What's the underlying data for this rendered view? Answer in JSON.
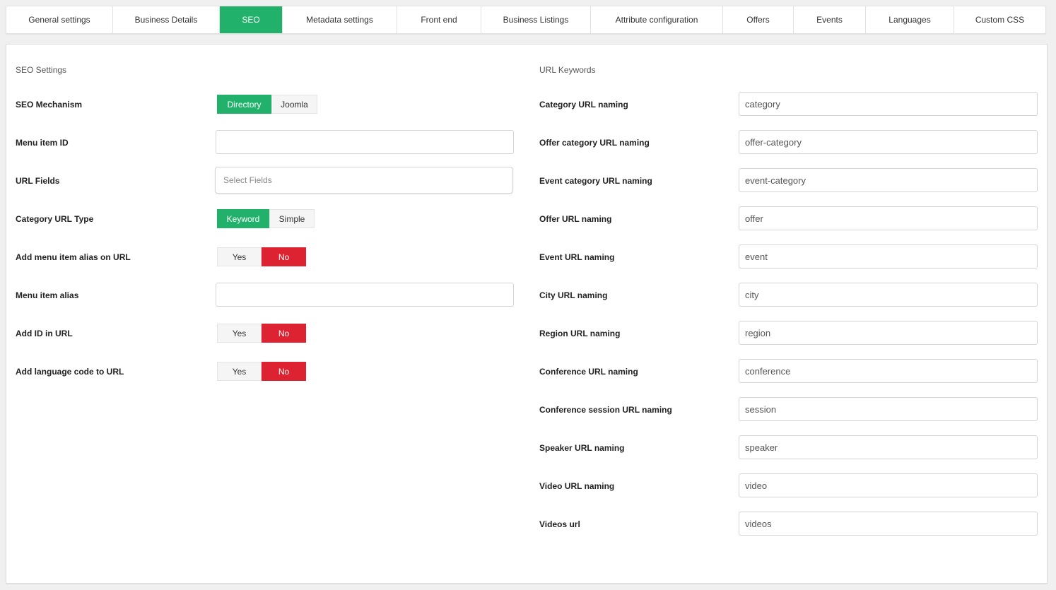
{
  "tabs": [
    {
      "label": "General settings",
      "active": false
    },
    {
      "label": "Business Details",
      "active": false
    },
    {
      "label": "SEO",
      "active": true
    },
    {
      "label": "Metadata settings",
      "active": false
    },
    {
      "label": "Front end",
      "active": false
    },
    {
      "label": "Business Listings",
      "active": false
    },
    {
      "label": "Attribute configuration",
      "active": false
    },
    {
      "label": "Offers",
      "active": false
    },
    {
      "label": "Events",
      "active": false
    },
    {
      "label": "Languages",
      "active": false
    },
    {
      "label": "Custom CSS",
      "active": false
    }
  ],
  "seo": {
    "title": "SEO Settings",
    "mechanism": {
      "label": "SEO Mechanism",
      "options": [
        "Directory",
        "Joomla"
      ],
      "selected": "Directory"
    },
    "menu_item_id": {
      "label": "Menu item ID",
      "value": ""
    },
    "url_fields": {
      "label": "URL Fields",
      "placeholder": "Select Fields"
    },
    "category_url_type": {
      "label": "Category URL Type",
      "options": [
        "Keyword",
        "Simple"
      ],
      "selected": "Keyword"
    },
    "add_menu_alias": {
      "label": "Add menu item alias on URL",
      "options": [
        "Yes",
        "No"
      ],
      "selected": "No"
    },
    "menu_item_alias": {
      "label": "Menu item alias",
      "value": ""
    },
    "add_id": {
      "label": "Add ID in URL",
      "options": [
        "Yes",
        "No"
      ],
      "selected": "No"
    },
    "add_lang": {
      "label": "Add language code to URL",
      "options": [
        "Yes",
        "No"
      ],
      "selected": "No"
    }
  },
  "keywords": {
    "title": "URL Keywords",
    "fields": [
      {
        "label": "Category URL naming",
        "value": "category"
      },
      {
        "label": "Offer category URL naming",
        "value": "offer-category"
      },
      {
        "label": "Event category URL naming",
        "value": "event-category"
      },
      {
        "label": "Offer URL naming",
        "value": "offer"
      },
      {
        "label": "Event URL naming",
        "value": "event"
      },
      {
        "label": "City URL naming",
        "value": "city"
      },
      {
        "label": "Region URL naming",
        "value": "region"
      },
      {
        "label": "Conference URL naming",
        "value": "conference"
      },
      {
        "label": "Conference session URL naming",
        "value": "session"
      },
      {
        "label": "Speaker URL naming",
        "value": "speaker"
      },
      {
        "label": "Video URL naming",
        "value": "video"
      },
      {
        "label": "Videos url",
        "value": "videos"
      }
    ]
  },
  "colors": {
    "green": "#21b16b",
    "red": "#dd2232"
  }
}
